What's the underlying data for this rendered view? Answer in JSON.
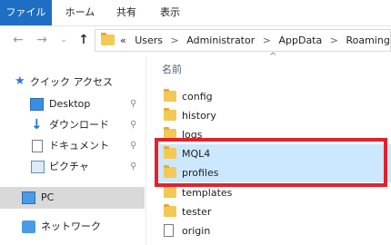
{
  "ribbon": {
    "tabs": [
      {
        "label": "ファイル"
      },
      {
        "label": "ホーム"
      },
      {
        "label": "共有"
      },
      {
        "label": "表示"
      }
    ]
  },
  "address": {
    "overflow": "«",
    "crumbs": [
      "Users",
      "Administrator",
      "AppData",
      "Roaming"
    ],
    "separator": ">"
  },
  "sidebar": {
    "quick_access": "クイック アクセス",
    "items": [
      {
        "label": "Desktop",
        "icon": "desktop-icon",
        "pinned": true
      },
      {
        "label": "ダウンロード",
        "icon": "download-icon",
        "pinned": true
      },
      {
        "label": "ドキュメント",
        "icon": "documents-icon",
        "pinned": true
      },
      {
        "label": "ピクチャ",
        "icon": "pictures-icon",
        "pinned": true
      }
    ],
    "pc": "PC",
    "network": "ネットワーク",
    "pin_glyph": "📌"
  },
  "list": {
    "column_name": "名前",
    "rows": [
      {
        "name": "config",
        "type": "folder",
        "selected": false
      },
      {
        "name": "history",
        "type": "folder",
        "selected": false
      },
      {
        "name": "logs",
        "type": "folder",
        "selected": false
      },
      {
        "name": "MQL4",
        "type": "folder",
        "selected": true
      },
      {
        "name": "profiles",
        "type": "folder",
        "selected": true
      },
      {
        "name": "templates",
        "type": "folder",
        "selected": false
      },
      {
        "name": "tester",
        "type": "folder",
        "selected": false
      },
      {
        "name": "origin",
        "type": "file",
        "selected": false
      }
    ]
  },
  "colors": {
    "file_tab": "#1e6fc3",
    "selection": "#cce8ff",
    "highlight_border": "#e3212d"
  }
}
